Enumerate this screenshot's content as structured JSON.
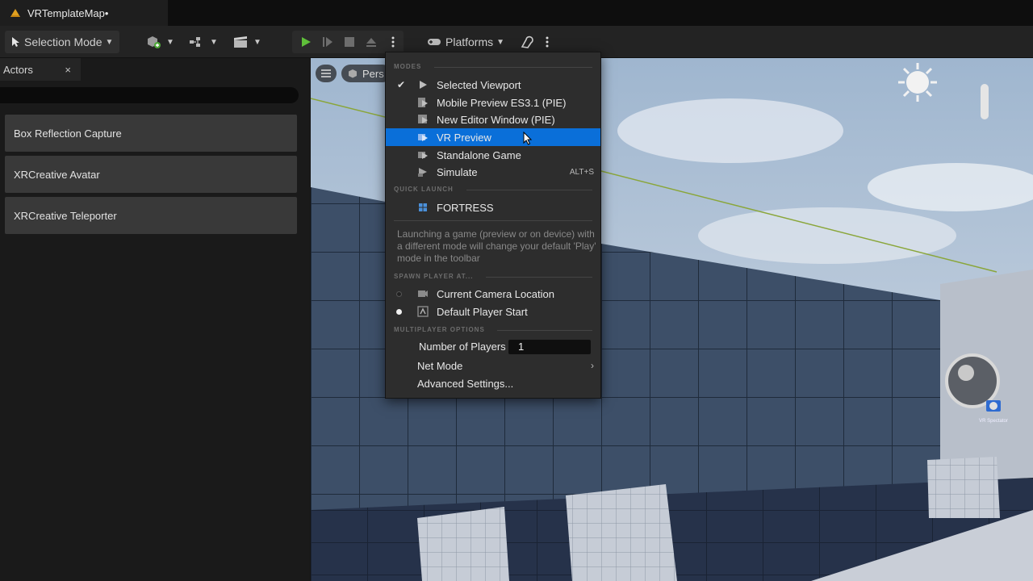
{
  "window": {
    "tab_title": "VRTemplateMap•"
  },
  "toolbar": {
    "selection_mode": "Selection Mode",
    "platforms": "Platforms"
  },
  "outliner": {
    "tab_label": "Actors",
    "close": "×",
    "items": [
      {
        "label": "Box Reflection Capture"
      },
      {
        "label": "XRCreative Avatar"
      },
      {
        "label": "XRCreative Teleporter"
      }
    ]
  },
  "viewport": {
    "perspective_label": "Pers",
    "corner_label": "VR Spectator"
  },
  "play_menu": {
    "section_modes": "MODES",
    "modes": [
      {
        "label": "Selected Viewport",
        "checked": true,
        "shortcut": ""
      },
      {
        "label": "Mobile Preview ES3.1 (PIE)",
        "checked": false,
        "shortcut": ""
      },
      {
        "label": "New Editor Window (PIE)",
        "checked": false,
        "shortcut": ""
      },
      {
        "label": "VR Preview",
        "checked": false,
        "shortcut": "",
        "highlighted": true
      },
      {
        "label": "Standalone Game",
        "checked": false,
        "shortcut": ""
      },
      {
        "label": "Simulate",
        "checked": false,
        "shortcut": "ALT+S"
      }
    ],
    "section_quick_launch": "QUICK LAUNCH",
    "quick_launch_item": "FORTRESS",
    "hint": "Launching a game (preview or on device) with a different mode will change your default 'Play' mode in the toolbar",
    "section_spawn": "SPAWN PLAYER AT...",
    "spawn_options": [
      {
        "label": "Current Camera Location",
        "selected": false
      },
      {
        "label": "Default Player Start",
        "selected": true
      }
    ],
    "section_multiplayer": "MULTIPLAYER OPTIONS",
    "number_of_players_label": "Number of Players",
    "number_of_players_value": "1",
    "net_mode": "Net Mode",
    "advanced_settings": "Advanced Settings..."
  },
  "colors": {
    "highlight": "#0a6fd9",
    "play_green": "#5fbf3a"
  }
}
